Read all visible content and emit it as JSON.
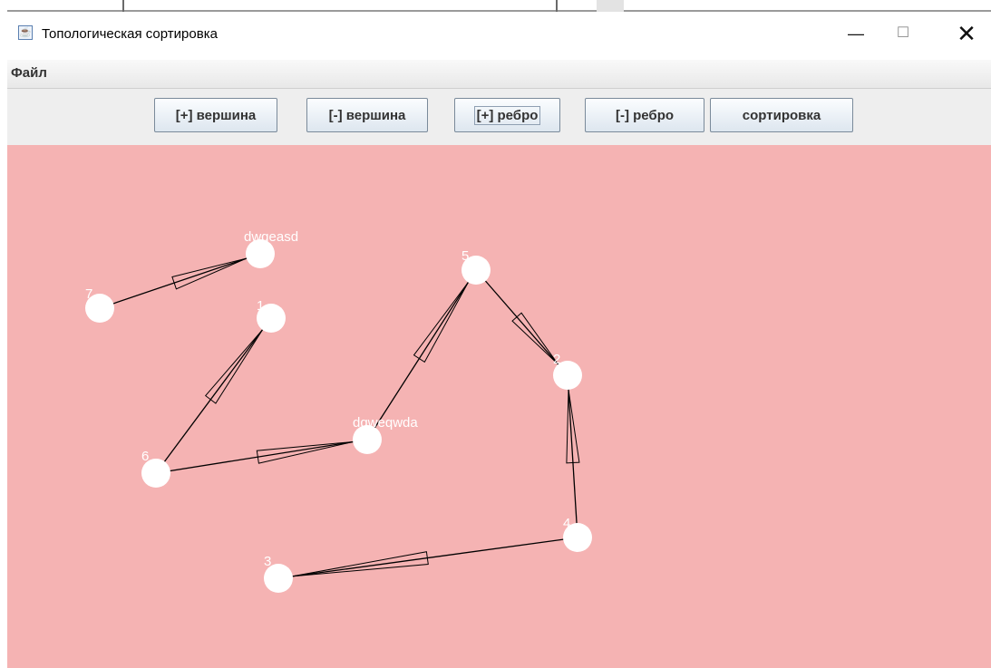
{
  "window": {
    "title": "Топологическая сортировка",
    "minimize": "—",
    "maximize": "☐",
    "close": "✕"
  },
  "menu": {
    "items": [
      "Файл"
    ]
  },
  "toolbar": {
    "buttons": [
      {
        "label": "[+] вершина",
        "name": "add-vertex-button"
      },
      {
        "label": "[-] вершина",
        "name": "remove-vertex-button"
      },
      {
        "label": "[+] ребро",
        "name": "add-edge-button",
        "focused": true
      },
      {
        "label": "[-] ребро",
        "name": "remove-edge-button"
      },
      {
        "label": "сортировка",
        "name": "sort-button"
      }
    ]
  },
  "graph": {
    "colors": {
      "background": "#f5b3b3",
      "vertex": "#ffffff",
      "edge": "#000000",
      "label": "#ffffff"
    },
    "vertices": [
      {
        "id": "dwqeasd",
        "label": "dwqeasd"
      },
      {
        "id": "7",
        "label": "7"
      },
      {
        "id": "1",
        "label": "1"
      },
      {
        "id": "5",
        "label": "5"
      },
      {
        "id": "2",
        "label": "2"
      },
      {
        "id": "dqweqwda",
        "label": "dqweqwda"
      },
      {
        "id": "6",
        "label": "6"
      },
      {
        "id": "4",
        "label": "4"
      },
      {
        "id": "3",
        "label": "3"
      }
    ],
    "edges": [
      {
        "from": "7",
        "to": "dwqeasd"
      },
      {
        "from": "6",
        "to": "1"
      },
      {
        "from": "6",
        "to": "dqweqwda"
      },
      {
        "from": "dqweqwda",
        "to": "5"
      },
      {
        "from": "5",
        "to": "2"
      },
      {
        "from": "4",
        "to": "2"
      },
      {
        "from": "4",
        "to": "3"
      }
    ]
  }
}
